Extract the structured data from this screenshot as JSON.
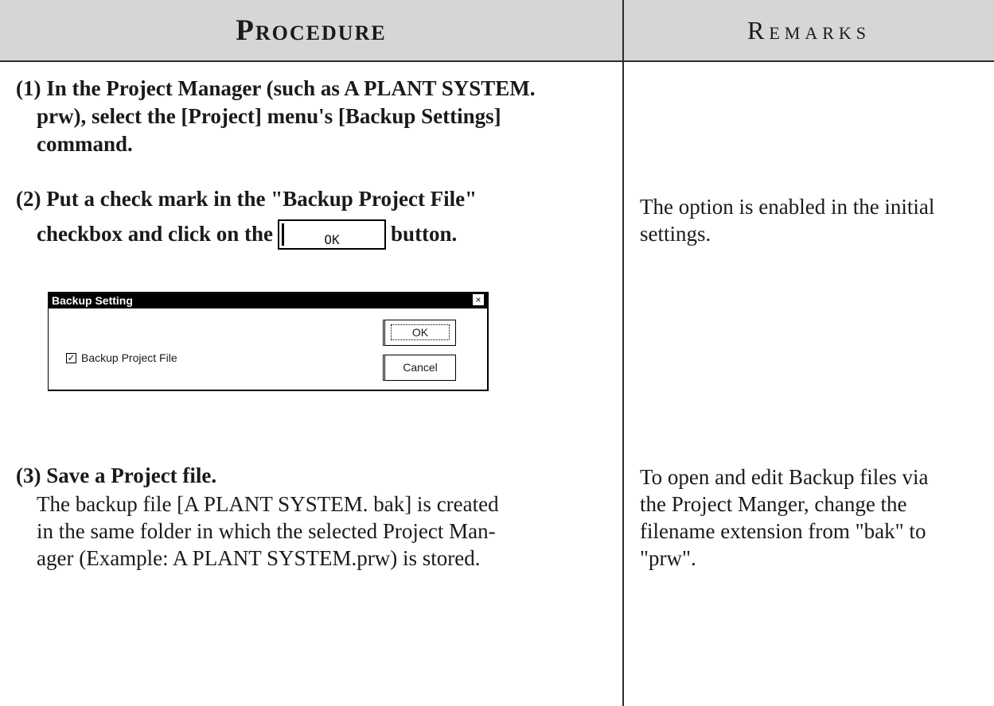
{
  "header": {
    "procedure_title": "Procedure",
    "remarks_title": "Remarks"
  },
  "steps": [
    {
      "title_lines": [
        "(1) In the Project Manager (such as A PLANT SYSTEM.",
        "prw), select the [Project] menu's [Backup Settings]",
        "command."
      ]
    },
    {
      "title_line1": "(2) Put a check mark in the \"Backup Project File\"",
      "title_line2_before": "checkbox and click on the",
      "inline_button": "OK",
      "title_line2_after": "button."
    },
    {
      "title": "(3) Save a Project file.",
      "body_lines": [
        "The backup file [A PLANT SYSTEM. bak] is created",
        "in the same folder in which the selected Project Man-",
        "ager (Example: A PLANT SYSTEM.prw) is stored."
      ]
    }
  ],
  "dialog": {
    "title": "Backup Setting",
    "close_glyph": "×",
    "checkbox_label": "Backup Project File",
    "checkbox_checked": true,
    "ok_label": "OK",
    "cancel_label": "Cancel"
  },
  "remarks": {
    "step2_lines": [
      "The option is enabled in the initial",
      "settings."
    ],
    "step3_lines": [
      "To open and edit Backup files via",
      "the Project Manger, change the",
      "filename extension from \"bak\" to",
      "\"prw\"."
    ]
  }
}
